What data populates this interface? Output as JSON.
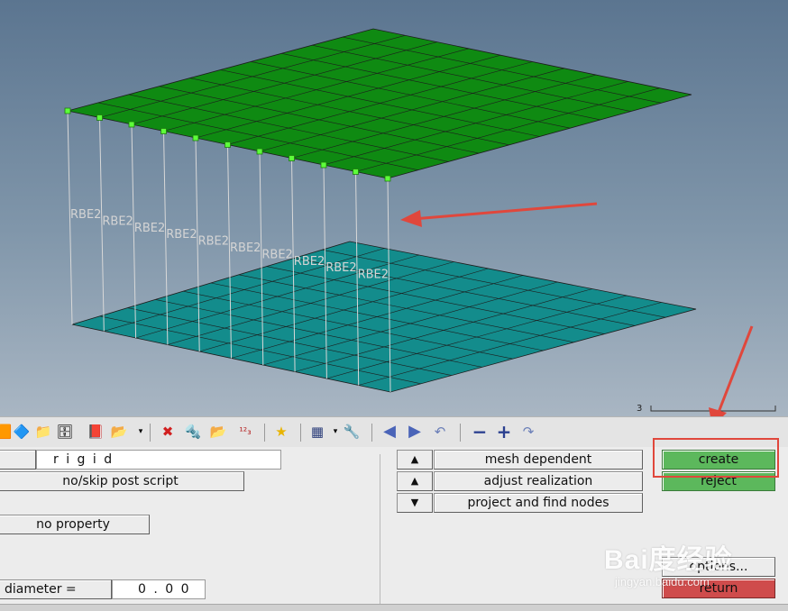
{
  "viewport": {
    "element_label": "RBE2",
    "scale_value": "3"
  },
  "toolbar": {
    "icons": [
      "components-icon",
      "assemblies-icon",
      "include-icon",
      "database-icon",
      "export-icon",
      "import-icon",
      "delete-icon",
      "mask-icon",
      "folder-icon",
      "numbers-icon",
      "favorite-icon",
      "display-grid-icon",
      "wrench-icon",
      "arrow-left-icon",
      "arrow-right-icon",
      "undo-icon",
      "zoom-out-icon",
      "zoom-in-icon",
      "redo-icon"
    ]
  },
  "panel": {
    "name_field_value": "r i g i d",
    "post_script_label": "no/skip post script",
    "property_label": "no property",
    "diameter_label": "diameter =",
    "diameter_value": "0 . 0 0",
    "mesh_dependent_label": "mesh dependent",
    "adjust_realization_label": "adjust realization",
    "project_find_nodes_label": "project and find nodes",
    "create_label": "create",
    "reject_label": "reject",
    "options_label": "options...",
    "return_label": "return"
  },
  "watermark": {
    "logo_text": "Bai度经验",
    "sub_text": "jingyan.baidu.com"
  },
  "colors": {
    "upper_mesh": "#0f8a12",
    "lower_mesh": "#138c8c",
    "annotation_arrow": "#e0473c",
    "create_button": "#5cb85c",
    "return_button": "#cf4c4c"
  }
}
